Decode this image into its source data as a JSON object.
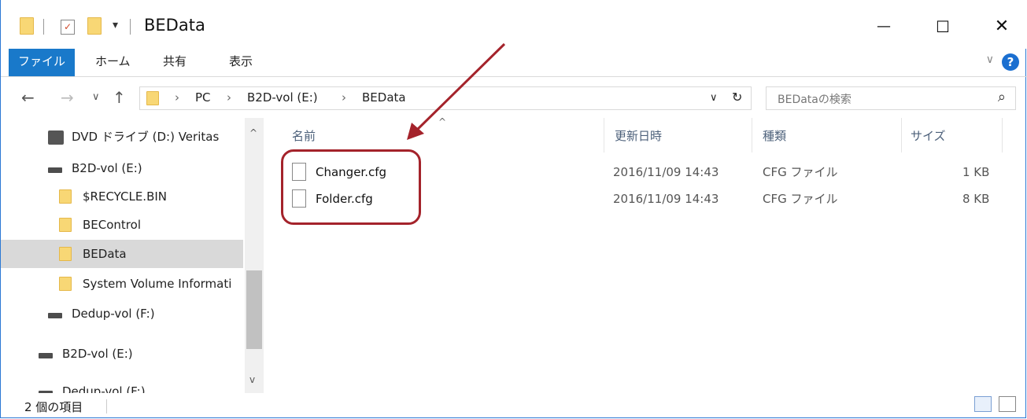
{
  "window": {
    "title": "BEData",
    "qa_dropdown": "▾",
    "minimize": "—",
    "maximize": "☐",
    "close": "✕"
  },
  "ribbon": {
    "tabs": [
      {
        "label": "ファイル"
      },
      {
        "label": "ホーム"
      },
      {
        "label": "共有"
      },
      {
        "label": "表示"
      }
    ],
    "collapse_icon": "∨",
    "help_icon": "?"
  },
  "nav": {
    "back": "←",
    "forward": "→",
    "recent": "∨",
    "up": "↑",
    "breadcrumb": [
      "PC",
      "B2D-vol (E:)",
      "BEData"
    ],
    "separator": "›",
    "address_dropdown": "∨",
    "refresh": "↻",
    "search_placeholder": "BEDataの検索",
    "search_icon": "⌕"
  },
  "sidebar": {
    "items": [
      {
        "label": "DVD ドライブ (D:) Veritas",
        "icon": "dvd-drive-icon"
      },
      {
        "label": "B2D-vol (E:)",
        "icon": "drive-icon"
      },
      {
        "label": "$RECYCLE.BIN",
        "icon": "folder-icon"
      },
      {
        "label": "BEControl",
        "icon": "folder-icon"
      },
      {
        "label": "BEData",
        "icon": "folder-icon",
        "selected": true
      },
      {
        "label": "System Volume Informati",
        "icon": "folder-icon"
      },
      {
        "label": "Dedup-vol (F:)",
        "icon": "drive-icon"
      },
      {
        "label": "B2D-vol (E:)",
        "icon": "drive-icon"
      },
      {
        "label": "Dedup-vol (F:)",
        "icon": "drive-icon"
      }
    ],
    "scroll_up": "^",
    "scroll_down": "v"
  },
  "columns": {
    "name": "名前",
    "modified": "更新日時",
    "type": "種類",
    "size": "サイズ",
    "sort_indicator": "^"
  },
  "files": [
    {
      "name": "Changer.cfg",
      "modified": "2016/11/09 14:43",
      "type": "CFG ファイル",
      "size": "1 KB"
    },
    {
      "name": "Folder.cfg",
      "modified": "2016/11/09 14:43",
      "type": "CFG ファイル",
      "size": "8 KB"
    }
  ],
  "status": {
    "item_count": "2 個の項目"
  },
  "colors": {
    "accent": "#1979ca",
    "annotation": "#a4232b",
    "selection": "#d9d9d9"
  }
}
